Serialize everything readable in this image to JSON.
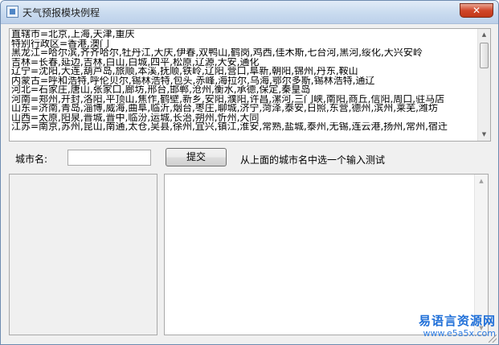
{
  "window": {
    "title": "天气预报模块例程",
    "close_label": "✕"
  },
  "city_list": [
    "直辖市=北京,上海,天津,重庆",
    "特别行政区=香港,澳门",
    "黑龙江=哈尔滨,齐齐哈尔,牡丹江,大庆,伊春,双鸭山,鹤岗,鸡西,佳木斯,七台河,黑河,绥化,大兴安岭",
    "吉林=长春,延边,吉林,白山,白城,四平,松原,辽源,大安,通化",
    "辽宁=沈阳,大连,葫芦岛,旅顺,本溪,抚顺,铁岭,辽阳,营口,阜新,朝阳,锦州,丹东,鞍山",
    "内蒙古=呼和浩特,呼伦贝尔,锡林浩特,包头,赤峰,海拉尔,乌海,鄂尔多斯,锡林浩特,通辽",
    "河北=石家庄,唐山,张家口,廊坊,邢台,邯郸,沧州,衡水,承德,保定,秦皇岛",
    "河南=郑州,开封,洛阳,平顶山,焦作,鹤壁,新乡,安阳,濮阳,许昌,漯河,三门峡,南阳,商丘,信阳,周口,驻马店",
    "山东=济南,青岛,淄博,威海,曲阜,临沂,烟台,枣庄,聊城,济宁,菏泽,泰安,日照,东营,德州,滨州,莱芜,潍坊",
    "山西=太原,阳泉,晋城,晋中,临汾,运城,长治,朔州,忻州,大同",
    "江苏=南京,苏州,昆山,南通,太仓,吴县,徐州,宜兴,镇江,淮安,常熟,盐城,泰州,无锡,连云港,扬州,常州,宿迁"
  ],
  "form": {
    "city_label": "城市名:",
    "city_input_value": "",
    "submit_label": "提交",
    "hint": "从上面的城市名中选一个输入测试"
  },
  "watermark": {
    "name": "易语言资源网",
    "url": "www.e5a5x.com"
  },
  "icons": {
    "app": "window-app-icon",
    "scroll_up": "▲",
    "scroll_down": "▼"
  },
  "colors": {
    "close_button": "#c94527",
    "titlebar": "#c9dbef",
    "watermark": "#1f6fd8"
  }
}
